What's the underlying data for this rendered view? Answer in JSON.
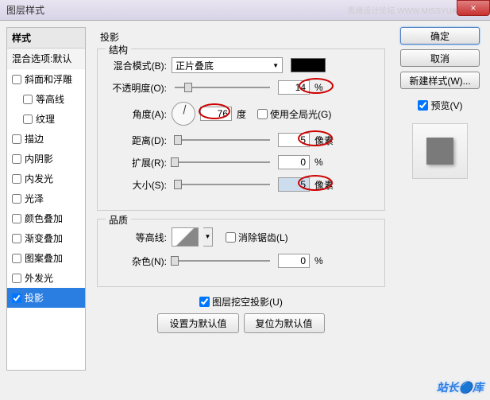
{
  "title": "图层样式",
  "titlebar_right": "思缘设计论坛  WWW.MISSYUAN.COM",
  "close": "×",
  "left": {
    "header": "样式",
    "subheader": "混合选项:默认",
    "items": [
      {
        "label": "斜面和浮雕",
        "indent": false
      },
      {
        "label": "等高线",
        "indent": true
      },
      {
        "label": "纹理",
        "indent": true
      },
      {
        "label": "描边",
        "indent": false
      },
      {
        "label": "内阴影",
        "indent": false
      },
      {
        "label": "内发光",
        "indent": false
      },
      {
        "label": "光泽",
        "indent": false
      },
      {
        "label": "颜色叠加",
        "indent": false
      },
      {
        "label": "渐变叠加",
        "indent": false
      },
      {
        "label": "图案叠加",
        "indent": false
      },
      {
        "label": "外发光",
        "indent": false
      },
      {
        "label": "投影",
        "indent": false,
        "checked": true,
        "selected": true
      }
    ]
  },
  "center": {
    "title": "投影",
    "structure": {
      "legend": "结构",
      "blend_mode_label": "混合模式(B):",
      "blend_mode_value": "正片叠底",
      "opacity_label": "不透明度(O):",
      "opacity_value": "14",
      "opacity_unit": "%",
      "angle_label": "角度(A):",
      "angle_value": "76",
      "angle_unit": "度",
      "global_light_label": "使用全局光(G)",
      "distance_label": "距离(D):",
      "distance_value": "5",
      "distance_unit": "像素",
      "spread_label": "扩展(R):",
      "spread_value": "0",
      "spread_unit": "%",
      "size_label": "大小(S):",
      "size_value": "5",
      "size_unit": "像素"
    },
    "quality": {
      "legend": "品质",
      "contour_label": "等高线:",
      "antialias_label": "消除锯齿(L)",
      "noise_label": "杂色(N):",
      "noise_value": "0",
      "noise_unit": "%"
    },
    "knockout_label": "图层挖空投影(U)",
    "reset_label": "设置为默认值",
    "restore_label": "复位为默认值"
  },
  "right": {
    "ok": "确定",
    "cancel": "取消",
    "new_style": "新建样式(W)...",
    "preview_label": "预览(V)"
  },
  "watermark": "站长🔵库"
}
